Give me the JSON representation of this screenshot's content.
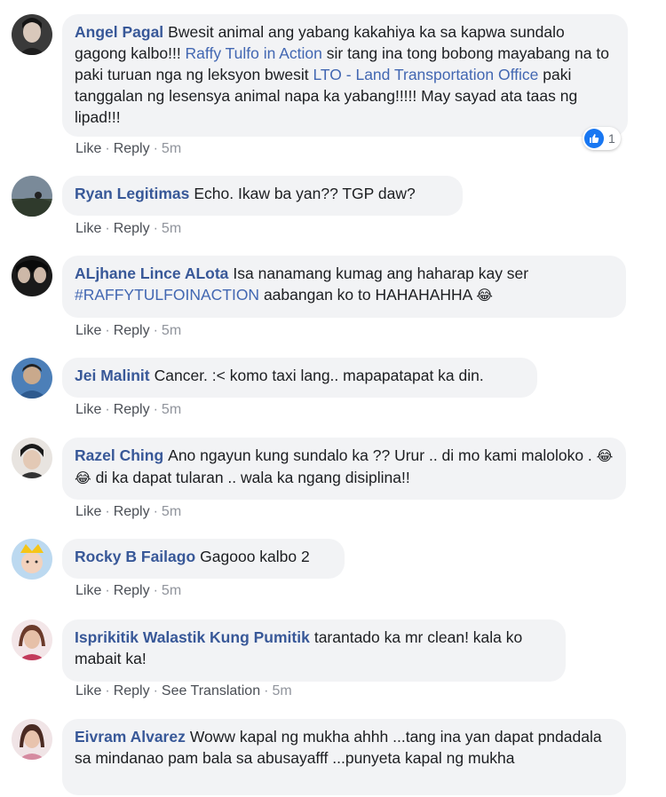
{
  "comments": [
    {
      "author": "Angel Pagal",
      "segments": [
        {
          "text": "Bwesit animal ang yabang kakahiya ka sa kapwa sundalo gagong kalbo!!! "
        },
        {
          "text": "Raffy Tulfo in Action",
          "mention": true
        },
        {
          "text": " sir tang ina tong bobong mayabang na to paki turuan nga ng leksyon bwesit "
        },
        {
          "text": "LTO - Land Transportation Office",
          "mention": true
        },
        {
          "text": " paki tanggalan ng lesensya animal napa ka yabang!!!!! May sayad ata taas ng lipad!!!"
        }
      ],
      "actions": [
        "Like",
        "Reply"
      ],
      "time": "5m",
      "reaction_count": "1"
    },
    {
      "author": "Ryan Legitimas",
      "segments": [
        {
          "text": "Echo. Ikaw ba yan?? TGP daw?"
        }
      ],
      "actions": [
        "Like",
        "Reply"
      ],
      "time": "5m"
    },
    {
      "author": "ALjhane Lince ALota",
      "segments": [
        {
          "text": "Isa nanamang kumag ang haharap kay ser "
        },
        {
          "text": "#RAFFYTULFOINACTION",
          "mention": true
        },
        {
          "text": " aabangan ko to HAHAHAHHA "
        },
        {
          "text": "😂",
          "emoji": true
        }
      ],
      "actions": [
        "Like",
        "Reply"
      ],
      "time": "5m"
    },
    {
      "author": "Jei Malinit",
      "segments": [
        {
          "text": "Cancer. :< komo taxi lang.. mapapatapat ka din."
        }
      ],
      "actions": [
        "Like",
        "Reply"
      ],
      "time": "5m"
    },
    {
      "author": "Razel Ching",
      "segments": [
        {
          "text": "Ano ngayun kung sundalo ka ?? Urur .. di mo kami maloloko . "
        },
        {
          "text": "😂",
          "emoji": true
        },
        {
          "text": " "
        },
        {
          "text": "😂",
          "emoji": true
        },
        {
          "text": " di ka dapat tularan .. wala ka ngang disiplina!!"
        }
      ],
      "actions": [
        "Like",
        "Reply"
      ],
      "time": "5m"
    },
    {
      "author": "Rocky B Failago",
      "segments": [
        {
          "text": "Gagooo kalbo 2"
        }
      ],
      "actions": [
        "Like",
        "Reply"
      ],
      "time": "5m"
    },
    {
      "author": "Isprikitik Walastik Kung Pumitik",
      "segments": [
        {
          "text": "tarantado ka mr clean! kala ko mabait ka!"
        }
      ],
      "actions": [
        "Like",
        "Reply",
        "See Translation"
      ],
      "time": "5m"
    },
    {
      "author": "Eivram Alvarez",
      "segments": [
        {
          "text": "Woww kapal ng mukha ahhh ...tang ina yan dapat pndadala sa mindanao pam bala sa abusayafff ...punyeta kapal ng mukha"
        }
      ],
      "actions": [],
      "time": ""
    }
  ]
}
